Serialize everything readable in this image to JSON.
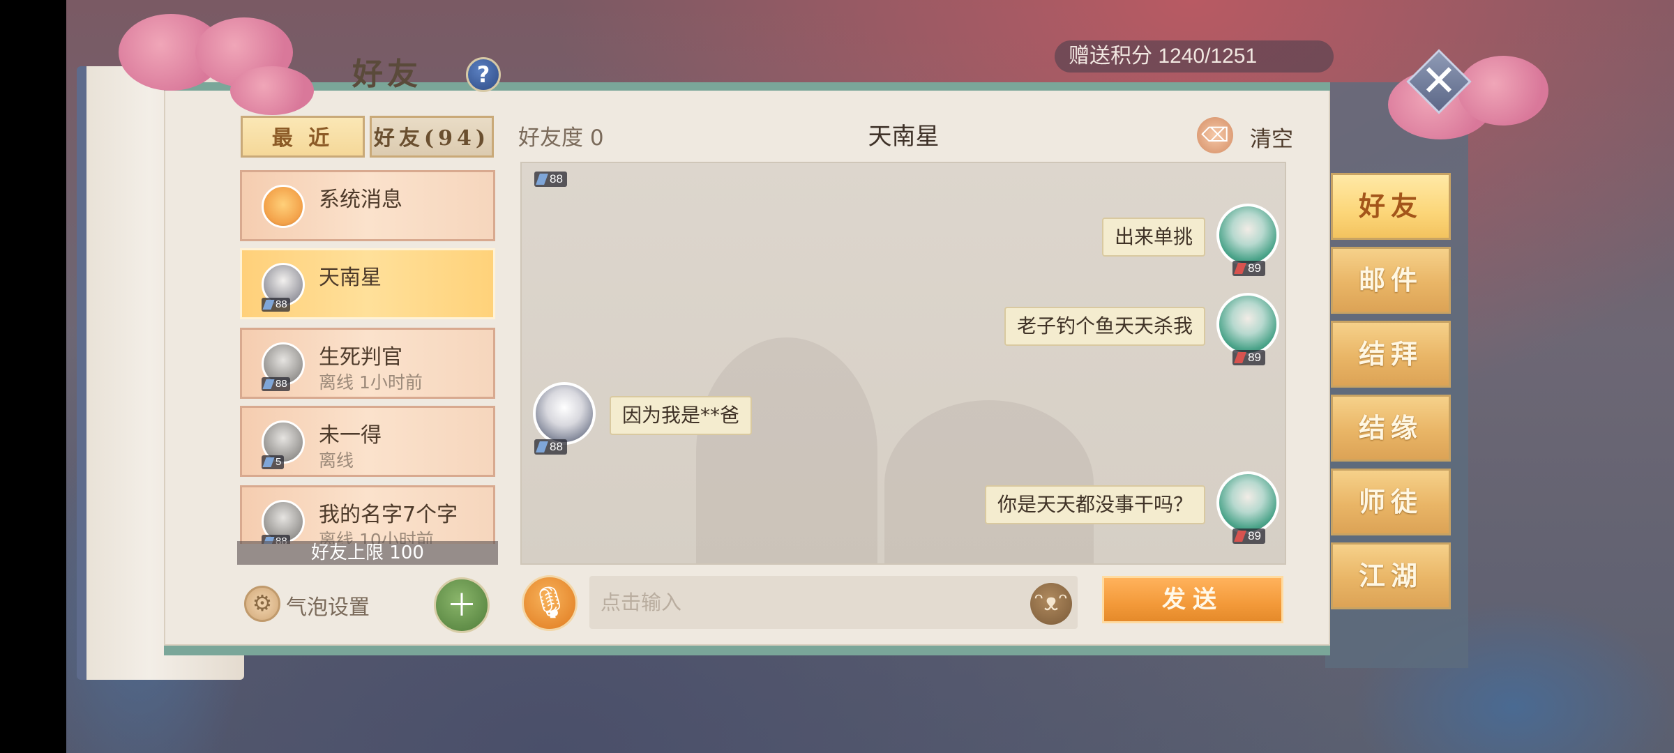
{
  "header": {
    "title": "好友",
    "help_label": "?",
    "points": "赠送积分 1240/1251",
    "close_label": "✕"
  },
  "left_tabs": {
    "recent": "最 近",
    "friends": "好友(94)"
  },
  "friends": [
    {
      "name": "系统消息",
      "status": "",
      "level": ""
    },
    {
      "name": "天南星",
      "status": "",
      "level": "88"
    },
    {
      "name": "生死判官",
      "status": "离线 1小时前",
      "level": "88"
    },
    {
      "name": "未一得",
      "status": "离线",
      "level": "5"
    },
    {
      "name": "我的名字7个字",
      "status": "离线 10小时前",
      "level": "88"
    }
  ],
  "friend_limit": "好友上限 100",
  "bubble_settings": "气泡设置",
  "chat": {
    "favor": "好友度 0",
    "title": "天南星",
    "clear": "清空",
    "top_level": "88",
    "messages": [
      {
        "side": "right",
        "text": "出来单挑",
        "level": "89"
      },
      {
        "side": "right",
        "text": "老子钓个鱼天天杀我",
        "level": "89"
      },
      {
        "side": "left",
        "text": "因为我是**爸",
        "level": "88"
      },
      {
        "side": "right",
        "text": "你是天天都没事干吗？",
        "level": "89"
      }
    ]
  },
  "input": {
    "placeholder": "点击输入",
    "send": "发送"
  },
  "right_tabs": [
    "好友",
    "邮件",
    "结拜",
    "结缘",
    "师徒",
    "江湖"
  ]
}
